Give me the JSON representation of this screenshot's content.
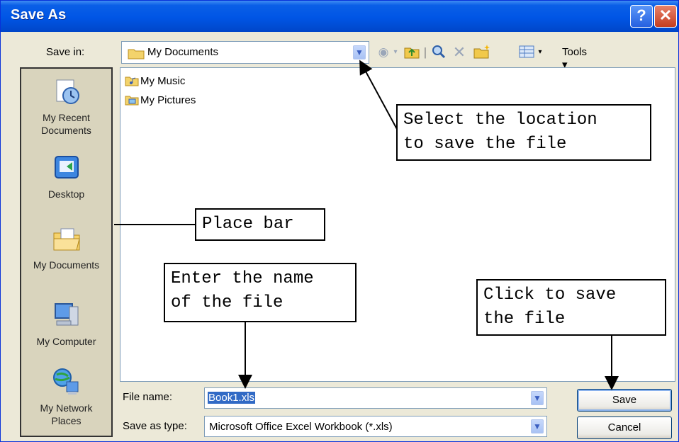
{
  "window": {
    "title": "Save As",
    "help_glyph": "?",
    "close_glyph": "✕"
  },
  "save_in": {
    "label": "Save in:",
    "value": "My Documents",
    "icon": "folder-icon"
  },
  "toolbar": {
    "icons": [
      "back-icon",
      "up-folder-icon",
      "search-web-icon",
      "delete-icon",
      "new-folder-icon",
      "views-icon"
    ],
    "tools_label": "Tools"
  },
  "place_bar": {
    "items": [
      {
        "label": "My Recent Documents",
        "icon": "recent-documents-icon"
      },
      {
        "label": "Desktop",
        "icon": "desktop-icon"
      },
      {
        "label": "My Documents",
        "icon": "my-documents-icon"
      },
      {
        "label": "My Computer",
        "icon": "my-computer-icon"
      },
      {
        "label": "My Network Places",
        "icon": "network-places-icon"
      }
    ]
  },
  "files": [
    {
      "name": "My Music",
      "icon": "music-folder-icon"
    },
    {
      "name": "My Pictures",
      "icon": "pictures-folder-icon"
    }
  ],
  "file_name": {
    "label": "File name:",
    "value": "Book1.xls"
  },
  "save_as_type": {
    "label": "Save as type:",
    "value": "Microsoft Office Excel Workbook (*.xls)"
  },
  "buttons": {
    "save": "Save",
    "cancel": "Cancel"
  },
  "callouts": {
    "location": "Select the location\nto save the file",
    "place_bar": "Place bar",
    "file_name": "Enter the name\nof the file",
    "save": "Click to save\nthe file"
  },
  "colors": {
    "title_bar": "#0055E5",
    "dialog_bg": "#ECE9D8",
    "selection": "#316AC5"
  }
}
